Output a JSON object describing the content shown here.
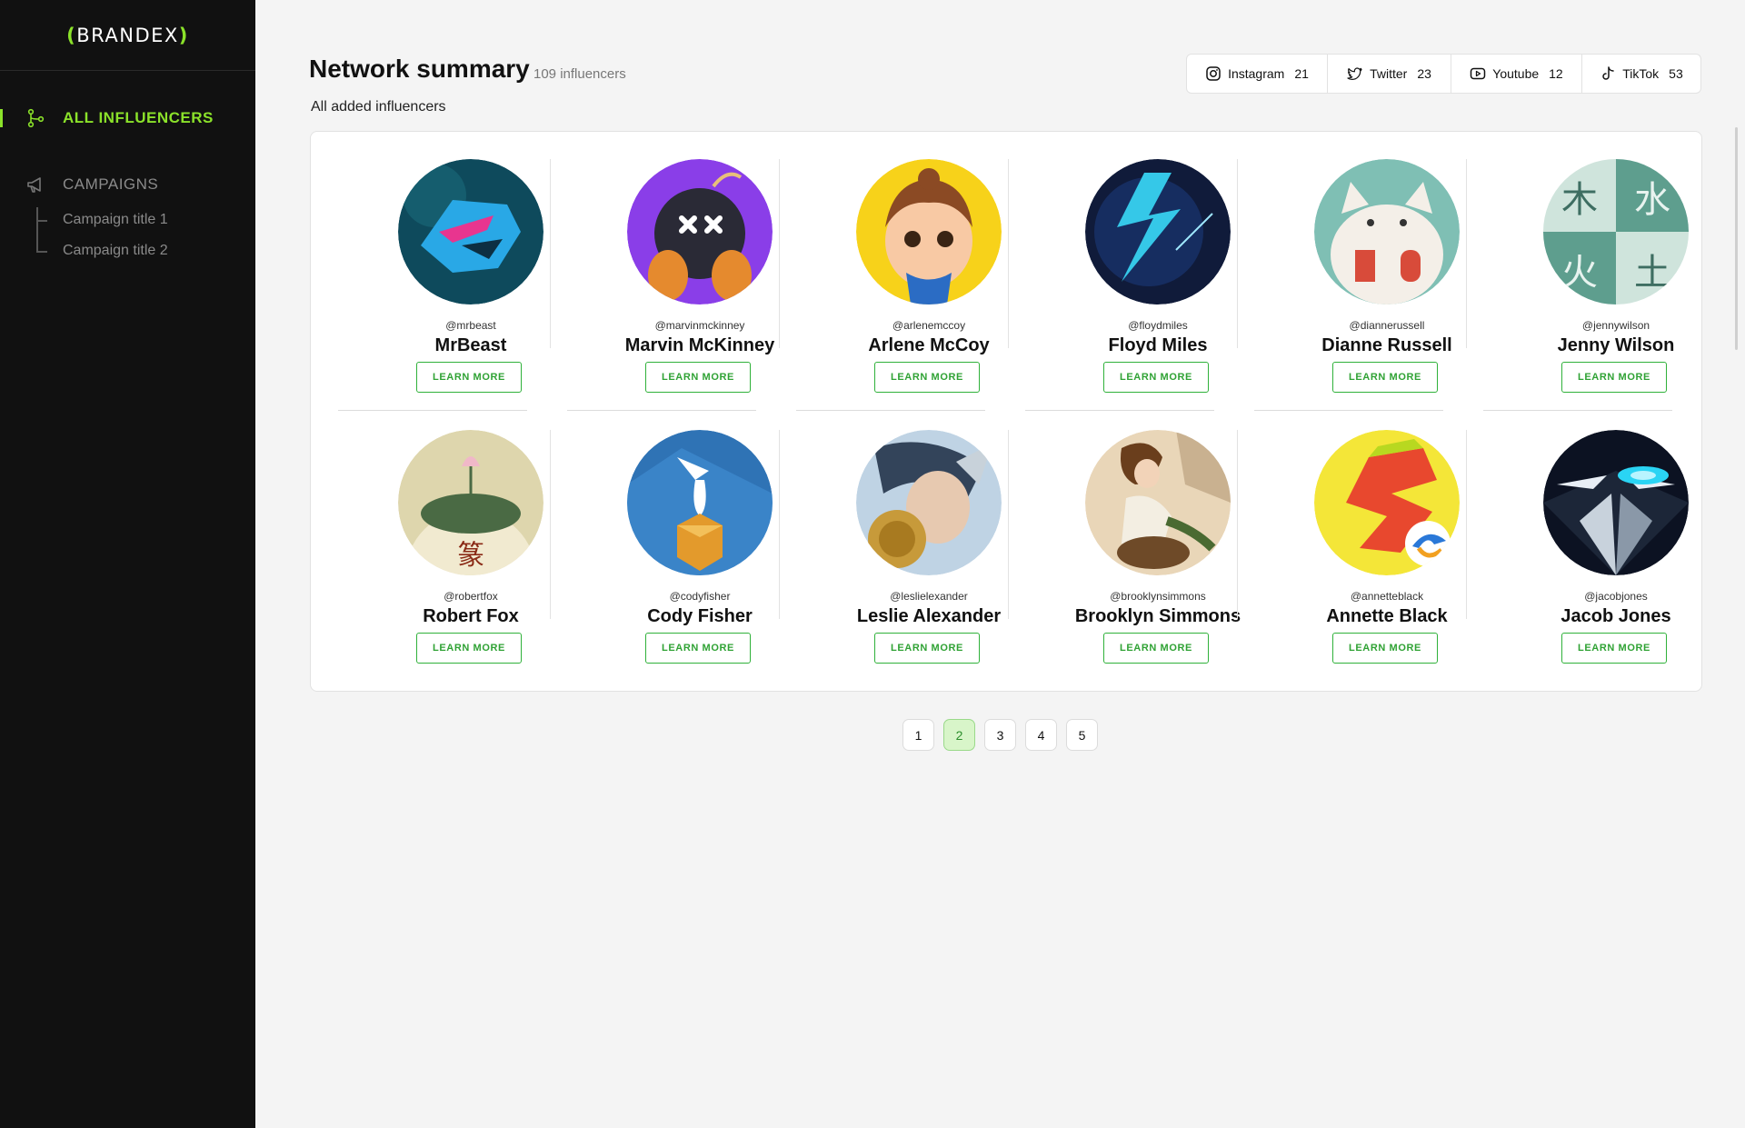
{
  "brand": {
    "left": "(",
    "name": "BRANDEX",
    "right": ")"
  },
  "sidebar": {
    "active_item": "ALL INFLUENCERS",
    "campaigns_label": "CAMPAIGNS",
    "campaigns": [
      "Campaign title 1",
      "Campaign title 2"
    ]
  },
  "header": {
    "title": "Network summary",
    "count": "109 influencers",
    "subtitle": "All added influencers"
  },
  "platforms": [
    {
      "name": "Instagram",
      "count": "21",
      "icon": "instagram-icon"
    },
    {
      "name": "Twitter",
      "count": "23",
      "icon": "twitter-icon"
    },
    {
      "name": "Youtube",
      "count": "12",
      "icon": "youtube-icon"
    },
    {
      "name": "TikTok",
      "count": "53",
      "icon": "tiktok-icon"
    }
  ],
  "button_label": "LEARN MORE",
  "influencers": [
    {
      "handle": "@mrbeast",
      "name": "MrBeast"
    },
    {
      "handle": "@marvinmckinney",
      "name": "Marvin McKinney"
    },
    {
      "handle": "@arlenemccoy",
      "name": "Arlene McCoy"
    },
    {
      "handle": "@floydmiles",
      "name": "Floyd Miles"
    },
    {
      "handle": "@diannerussell",
      "name": "Dianne Russell"
    },
    {
      "handle": "@jennywilson",
      "name": "Jenny Wilson"
    },
    {
      "handle": "@robertfox",
      "name": "Robert Fox"
    },
    {
      "handle": "@codyfisher",
      "name": "Cody Fisher"
    },
    {
      "handle": "@leslielexander",
      "name": "Leslie Alexander"
    },
    {
      "handle": "@brooklynsimmons",
      "name": "Brooklyn Simmons"
    },
    {
      "handle": "@annetteblack",
      "name": "Annette Black"
    },
    {
      "handle": "@jacobjones",
      "name": "Jacob Jones"
    }
  ],
  "pagination": {
    "pages": [
      "1",
      "2",
      "3",
      "4",
      "5"
    ],
    "current": "2"
  },
  "colors": {
    "accent": "#8be22a",
    "button_green": "#2fa234",
    "sidebar_bg": "#111111"
  }
}
